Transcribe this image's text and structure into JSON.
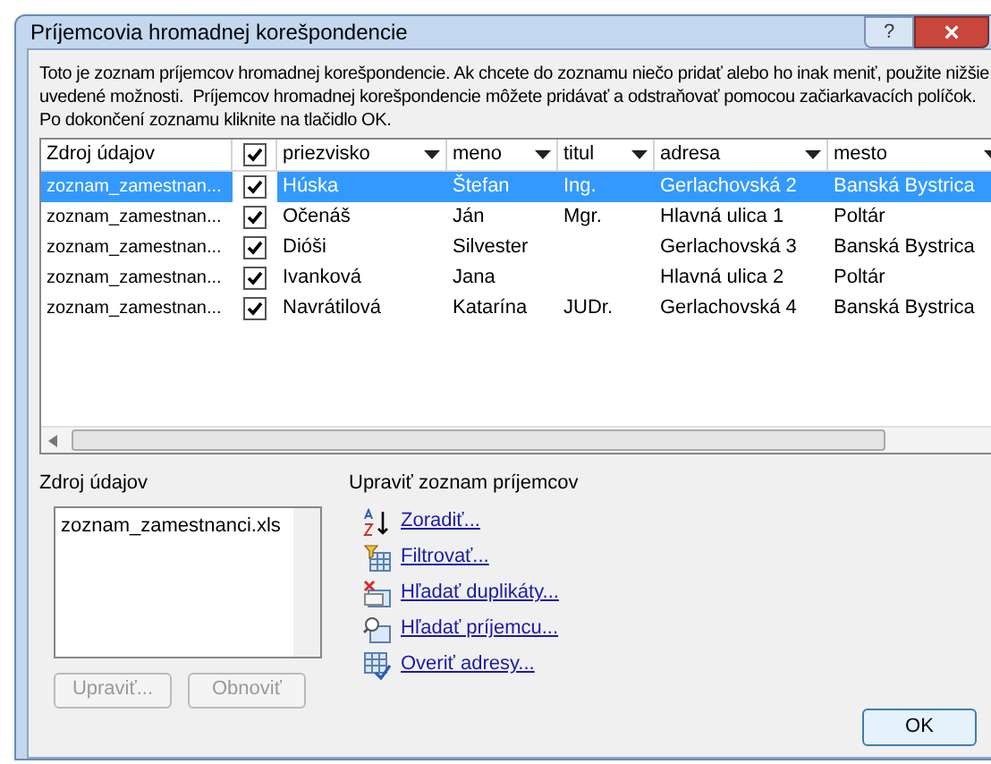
{
  "window": {
    "title": "Príjemcovia hromadnej korešpondencie",
    "help": "?",
    "close": "×"
  },
  "intro": [
    "Toto je zoznam príjemcov hromadnej korešpondencie. Ak chcete do zoznamu niečo pridať alebo ho inak meniť, použite nižšie",
    "uvedené možnosti.  Príjemcov hromadnej korešpondencie môžete pridávať a odstraňovať pomocou začiarkavacích políčok.",
    "Po dokončení zoznamu kliknite na tlačidlo OK."
  ],
  "table": {
    "source_column": "Zdroj údajov",
    "all_checked": true,
    "columns": [
      "priezvisko",
      "meno",
      "titul",
      "adresa",
      "mesto"
    ],
    "rows": [
      {
        "source": "zoznam_zamestnan...",
        "checked": true,
        "selected": true,
        "cells": [
          "Húska",
          "Štefan",
          "Ing.",
          "Gerlachovská 2",
          "Banská Bystrica"
        ]
      },
      {
        "source": "zoznam_zamestnan...",
        "checked": true,
        "selected": false,
        "cells": [
          "Očenáš",
          "Ján",
          "Mgr.",
          "Hlavná ulica 1",
          "Poltár"
        ]
      },
      {
        "source": "zoznam_zamestnan...",
        "checked": true,
        "selected": false,
        "cells": [
          "Dióši",
          "Silvester",
          "",
          "Gerlachovská 3",
          "Banská Bystrica"
        ]
      },
      {
        "source": "zoznam_zamestnan...",
        "checked": true,
        "selected": false,
        "cells": [
          "Ivanková",
          "Jana",
          "",
          "Hlavná ulica 2",
          "Poltár"
        ]
      },
      {
        "source": "zoznam_zamestnan...",
        "checked": true,
        "selected": false,
        "cells": [
          "Navrátilová",
          "Katarína",
          "JUDr.",
          "Gerlachovská 4",
          "Banská Bystrica"
        ]
      }
    ]
  },
  "data_source": {
    "label": "Zdroj údajov",
    "items": [
      "zoznam_zamestnanci.xls"
    ],
    "buttons": [
      {
        "label": "Upraviť...",
        "disabled": true
      },
      {
        "label": "Obnoviť",
        "disabled": true
      }
    ]
  },
  "refine": {
    "label": "Upraviť zoznam príjemcov",
    "links": [
      {
        "kind": "sort",
        "label": "Zoradiť..."
      },
      {
        "kind": "filter",
        "label": "Filtrovať..."
      },
      {
        "kind": "duplicates",
        "label": "Hľadať duplikáty..."
      },
      {
        "kind": "find",
        "label": "Hľadať príjemcu..."
      },
      {
        "kind": "validate",
        "label": "Overiť adresy..."
      }
    ]
  },
  "ok_button": "OK"
}
